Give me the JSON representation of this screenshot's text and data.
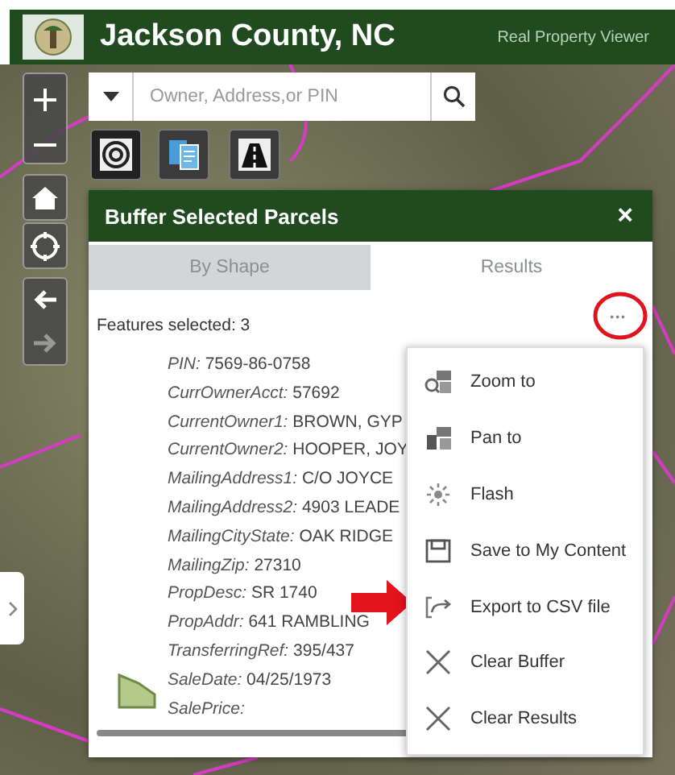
{
  "header": {
    "title": "Jackson County, NC",
    "subtitle": "Real Property Viewer"
  },
  "search": {
    "placeholder": "Owner, Address,or PIN"
  },
  "panel": {
    "title": "Buffer Selected Parcels",
    "close": "×",
    "tabs": [
      {
        "label": "By Shape",
        "selected": false
      },
      {
        "label": "Results",
        "selected": true
      }
    ],
    "features_selected": "Features selected: 3",
    "more": "•••",
    "attributes": [
      {
        "label": "PIN:",
        "value": "7569-86-0758"
      },
      {
        "label": "CurrOwnerAcct:",
        "value": "57692"
      },
      {
        "label": "CurrentOwner1:",
        "value": "BROWN, GYP"
      },
      {
        "label": "CurrentOwner2:",
        "value": "HOOPER, JOY"
      },
      {
        "label": "MailingAddress1:",
        "value": "C/O JOYCE"
      },
      {
        "label": "MailingAddress2:",
        "value": "4903 LEADE"
      },
      {
        "label": "MailingCityState:",
        "value": "OAK RIDGE"
      },
      {
        "label": "MailingZip:",
        "value": "27310"
      },
      {
        "label": "PropDesc:",
        "value": "SR 1740"
      },
      {
        "label": "PropAddr:",
        "value": "641 RAMBLING"
      },
      {
        "label": "TransferringRef:",
        "value": "395/437"
      },
      {
        "label": "SaleDate:",
        "value": "04/25/1973"
      },
      {
        "label": "SalePrice:"
      }
    ],
    "menu": [
      {
        "label": "Zoom to",
        "kind": "zoom"
      },
      {
        "label": "Pan to",
        "kind": "pan"
      },
      {
        "label": "Flash",
        "kind": "flash"
      },
      {
        "label": "Save to My Content",
        "kind": "save"
      },
      {
        "label": "Export to CSV file",
        "kind": "export"
      },
      {
        "label": "Clear Buffer",
        "kind": "clear"
      },
      {
        "label": "Clear Results",
        "kind": "clear"
      }
    ]
  }
}
